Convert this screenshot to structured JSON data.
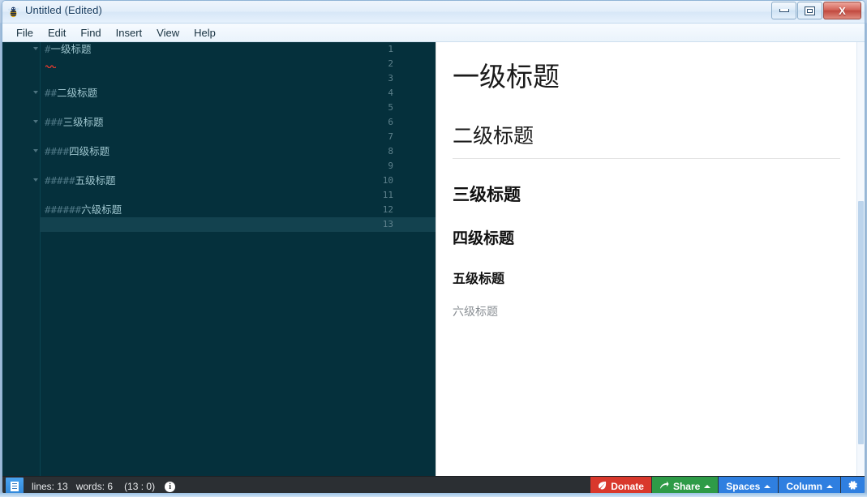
{
  "window": {
    "title": "Untitled (Edited)",
    "app_icon": "bee-icon",
    "controls": {
      "minimize": "minimize-icon",
      "restore": "restore-icon",
      "close": "X"
    }
  },
  "menubar": {
    "items": [
      {
        "label": "File"
      },
      {
        "label": "Edit"
      },
      {
        "label": "Find"
      },
      {
        "label": "Insert"
      },
      {
        "label": "View"
      },
      {
        "label": "Help"
      }
    ]
  },
  "editor": {
    "active_line": 13,
    "lines": [
      {
        "num": "1",
        "hash": "#",
        "text": "一级标题",
        "fold": true
      },
      {
        "num": "2",
        "hash": "",
        "text": "",
        "fold": false,
        "squiggle": true
      },
      {
        "num": "3",
        "hash": "",
        "text": "",
        "fold": false
      },
      {
        "num": "4",
        "hash": "##",
        "text": "二级标题",
        "fold": true
      },
      {
        "num": "5",
        "hash": "",
        "text": "",
        "fold": false
      },
      {
        "num": "6",
        "hash": "###",
        "text": "三级标题",
        "fold": true
      },
      {
        "num": "7",
        "hash": "",
        "text": "",
        "fold": false
      },
      {
        "num": "8",
        "hash": "####",
        "text": "四级标题",
        "fold": true
      },
      {
        "num": "9",
        "hash": "",
        "text": "",
        "fold": false
      },
      {
        "num": "10",
        "hash": "#####",
        "text": "五级标题",
        "fold": true
      },
      {
        "num": "11",
        "hash": "",
        "text": "",
        "fold": false
      },
      {
        "num": "12",
        "hash": "######",
        "text": "六级标题",
        "fold": false
      },
      {
        "num": "13",
        "hash": "",
        "text": "",
        "fold": false
      }
    ]
  },
  "preview": {
    "h1": "一级标题",
    "h2": "二级标题",
    "h3": "三级标题",
    "h4": "四级标题",
    "h5": "五级标题",
    "h6": "六级标题"
  },
  "statusbar": {
    "doc_icon": "document-icon",
    "lines_label": "lines: 13",
    "words_label": "words: 6",
    "position": "(13 : 0)",
    "info_icon": "i",
    "buttons": {
      "donate": "Donate",
      "share": "Share",
      "spaces": "Spaces",
      "column": "Column",
      "settings_icon": "gear-icon"
    }
  },
  "colors": {
    "editor_bg": "#05303c",
    "donate": "#d9382c",
    "share": "#2e9b47",
    "blue": "#2f7fe0",
    "statusbar_bg": "#2b2f33"
  }
}
